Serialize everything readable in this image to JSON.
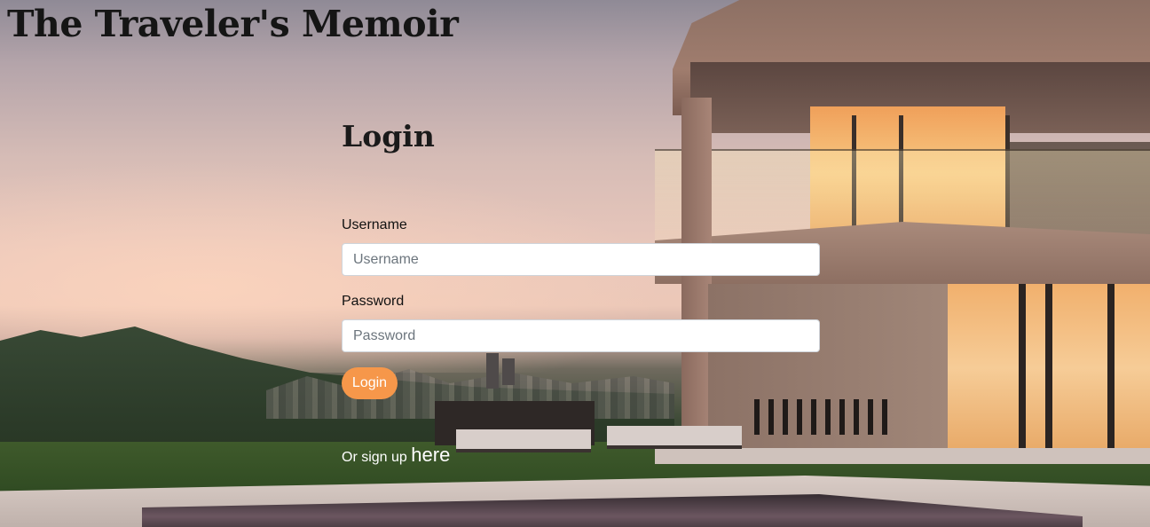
{
  "site": {
    "title": "The Traveler's Memoir"
  },
  "login_form": {
    "heading": "Login",
    "username": {
      "label": "Username",
      "value": "",
      "placeholder": "Username"
    },
    "password": {
      "label": "Password",
      "value": "",
      "placeholder": "Password"
    },
    "submit_label": "Login",
    "signup_prefix": "Or sign up",
    "signup_link_text": "here"
  },
  "colors": {
    "accent": "#f6974a",
    "title_text": "#151515",
    "signup_text": "#ffffff"
  }
}
